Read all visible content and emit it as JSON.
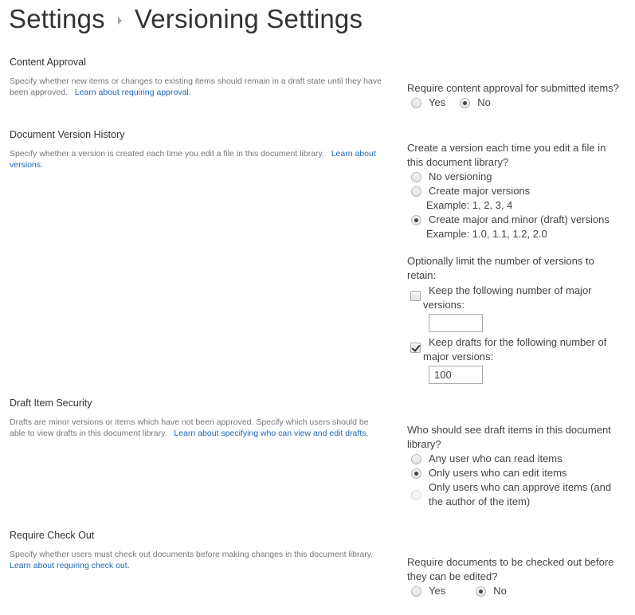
{
  "breadcrumb": {
    "parent": "Settings",
    "separator_icon": "triangle-right-icon",
    "current": "Versioning Settings"
  },
  "sections": {
    "content_approval": {
      "title": "Content Approval",
      "description": "Specify whether new items or changes to existing items should remain in a draft state until they have been approved.",
      "link": "Learn about requiring approval.",
      "question": "Require content approval for submitted items?",
      "options": [
        {
          "label": "Yes",
          "checked": false
        },
        {
          "label": "No",
          "checked": true
        }
      ]
    },
    "version_history": {
      "title": "Document Version History",
      "description": "Specify whether a version is created each time you edit a file in this document library.",
      "link": "Learn about versions.",
      "question": "Create a version each time you edit a file in this document library?",
      "options": [
        {
          "label": "No versioning",
          "example": "",
          "checked": false
        },
        {
          "label": "Create major versions",
          "example": "Example: 1, 2, 3, 4",
          "checked": false
        },
        {
          "label": "Create major and minor (draft) versions",
          "example": "Example: 1.0, 1.1, 1.2, 2.0",
          "checked": true
        }
      ],
      "limit_question": "Optionally limit the number of versions to retain:",
      "keep_major": {
        "label_line1": "Keep the following number of major",
        "label_line2": "versions:",
        "checked": false,
        "value": ""
      },
      "keep_drafts": {
        "label_line1": "Keep drafts for the following number of",
        "label_line2": "major versions:",
        "checked": true,
        "value": "100"
      }
    },
    "draft_security": {
      "title": "Draft Item Security",
      "description": "Drafts are minor versions or items which have not been approved. Specify which users should be able to view drafts in this document library.",
      "link": "Learn about specifying who can view and edit drafts.",
      "question": "Who should see draft items in this document library?",
      "options": [
        {
          "label": "Any user who can read items",
          "checked": false,
          "disabled": false
        },
        {
          "label": "Only users who can edit items",
          "checked": true,
          "disabled": false
        },
        {
          "label": "Only users who can approve items (and the author of the item)",
          "checked": false,
          "disabled": true
        }
      ]
    },
    "check_out": {
      "title": "Require Check Out",
      "description": "Specify whether users must check out documents before making changes in this document library.",
      "link": "Learn about requiring check out.",
      "question": "Require documents to be checked out before they can be edited?",
      "options": [
        {
          "label": "Yes",
          "checked": false
        },
        {
          "label": "No",
          "checked": true
        }
      ]
    }
  },
  "colors": {
    "link": "#1f67b0",
    "title_text": "#333333",
    "description_text": "#777777",
    "body_text": "#444444"
  }
}
